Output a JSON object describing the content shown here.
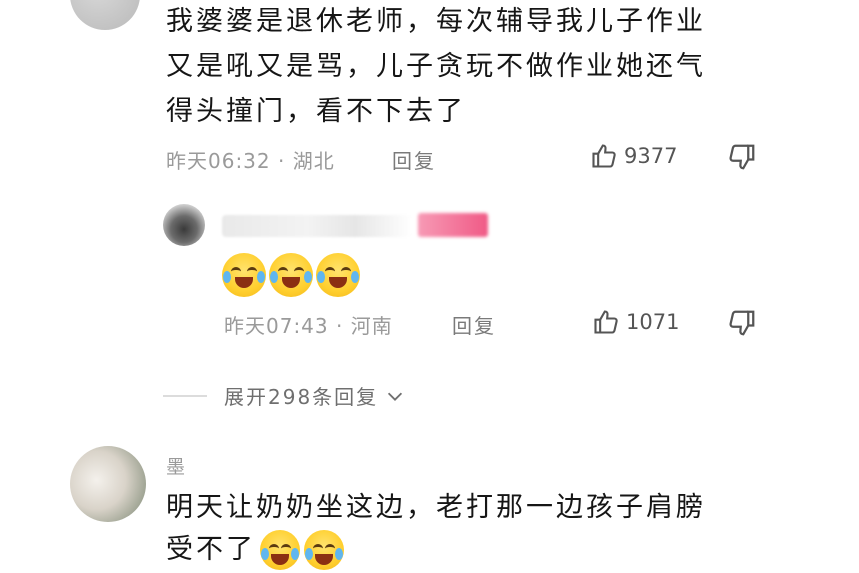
{
  "comment1": {
    "text_line1": "我婆婆是退休老师，每次辅导我儿子作业",
    "text_line2": "又是吼又是骂，儿子贪玩不做作业她还气",
    "text_line3": "得头撞门，看不下去了",
    "time_location": "昨天06:32 · 湖北",
    "reply_label": "回复",
    "like_count": "9377"
  },
  "reply1": {
    "time_location": "昨天07:43 · 河南",
    "reply_label": "回复",
    "like_count": "1071",
    "emojis": [
      "crying-laughing-emoji",
      "crying-laughing-emoji",
      "crying-laughing-emoji"
    ]
  },
  "expand": {
    "label": "展开298条回复"
  },
  "comment2": {
    "username": "墨",
    "text_line1": "明天让奶奶坐这边，老打那一边孩子肩膀",
    "text_line2": "受不了"
  },
  "colors": {
    "meta": "#9a9a9a",
    "text": "#161616",
    "emoji": "#ffcf2e"
  }
}
